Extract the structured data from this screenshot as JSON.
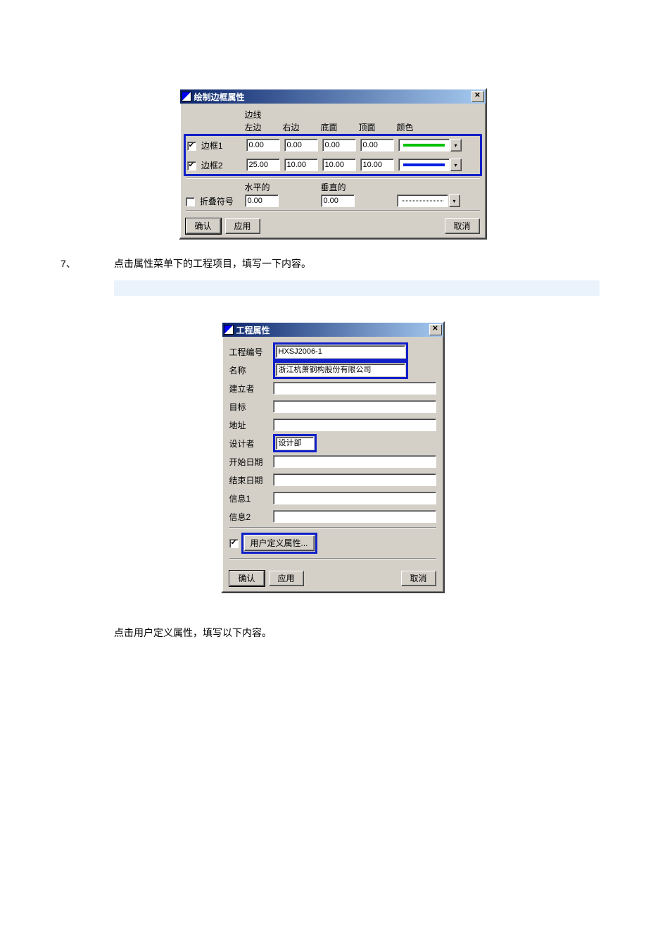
{
  "dlg1": {
    "title": "绘制边框属性",
    "close": "✕",
    "header_edges": "边线",
    "cols": {
      "left": "左边",
      "right": "右边",
      "bottom": "底面",
      "top": "顶面",
      "color": "颜色"
    },
    "row1": {
      "label": "边框1",
      "checked": true,
      "left": "0.00",
      "right": "0.00",
      "bottom": "0.00",
      "top": "0.00",
      "color": "#00c000"
    },
    "row2": {
      "label": "边框2",
      "checked": true,
      "left": "25.00",
      "right": "10.00",
      "bottom": "10.00",
      "top": "10.00",
      "color": "#0020e0"
    },
    "hv": {
      "h_label": "水平的",
      "v_label": "垂直的"
    },
    "fold": {
      "label": "折叠符号",
      "checked": false,
      "h": "0.00",
      "v": "0.00"
    },
    "buttons": {
      "ok": "确认",
      "apply": "应用",
      "cancel": "取消"
    }
  },
  "step": {
    "num": "7、",
    "text": "点击属性菜单下的工程项目，填写一下内容。"
  },
  "dlg2": {
    "title": "工程属性",
    "close": "✕",
    "fields": {
      "proj_no": {
        "label": "工程编号",
        "value": "HXSJ2006-1"
      },
      "name": {
        "label": "名称",
        "value": "浙江杭萧钢构股份有限公司"
      },
      "creator": {
        "label": "建立者",
        "value": ""
      },
      "target": {
        "label": "目标",
        "value": ""
      },
      "address": {
        "label": "地址",
        "value": ""
      },
      "designer": {
        "label": "设计者",
        "value": "设计部"
      },
      "start": {
        "label": "开始日期",
        "value": ""
      },
      "end": {
        "label": "结束日期",
        "value": ""
      },
      "info1": {
        "label": "信息1",
        "value": ""
      },
      "info2": {
        "label": "信息2",
        "value": ""
      }
    },
    "udp": {
      "checked": true,
      "button": "用户定义属性..."
    },
    "buttons": {
      "ok": "确认",
      "apply": "应用",
      "cancel": "取消"
    }
  },
  "para2": "点击用户定义属性，填写以下内容。"
}
